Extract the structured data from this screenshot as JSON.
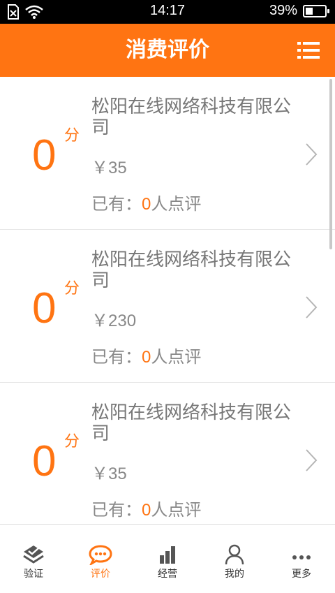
{
  "status_bar": {
    "time": "14:17",
    "battery": "39%",
    "battery_level": 0.39
  },
  "header": {
    "title": "消费评价",
    "menu_icon": "list-icon"
  },
  "colors": {
    "accent": "#ff7412",
    "text_gray": "#888888"
  },
  "items": [
    {
      "score": "0",
      "score_unit": "分",
      "name": "松阳在线网络科技有限公司",
      "price": "￥35",
      "review_prefix": "已有：",
      "review_count": "0",
      "review_suffix": "人点评"
    },
    {
      "score": "0",
      "score_unit": "分",
      "name": "松阳在线网络科技有限公司",
      "price": "￥230",
      "review_prefix": "已有：",
      "review_count": "0",
      "review_suffix": "人点评"
    },
    {
      "score": "0",
      "score_unit": "分",
      "name": "松阳在线网络科技有限公司",
      "price": "￥35",
      "review_prefix": "已有：",
      "review_count": "0",
      "review_suffix": "人点评"
    }
  ],
  "tabs": [
    {
      "label": "验证",
      "icon": "verify-icon",
      "active": false
    },
    {
      "label": "评价",
      "icon": "chat-bubble-icon",
      "active": true
    },
    {
      "label": "经营",
      "icon": "bar-chart-icon",
      "active": false
    },
    {
      "label": "我的",
      "icon": "user-icon",
      "active": false
    },
    {
      "label": "更多",
      "icon": "more-dots-icon",
      "active": false
    }
  ]
}
